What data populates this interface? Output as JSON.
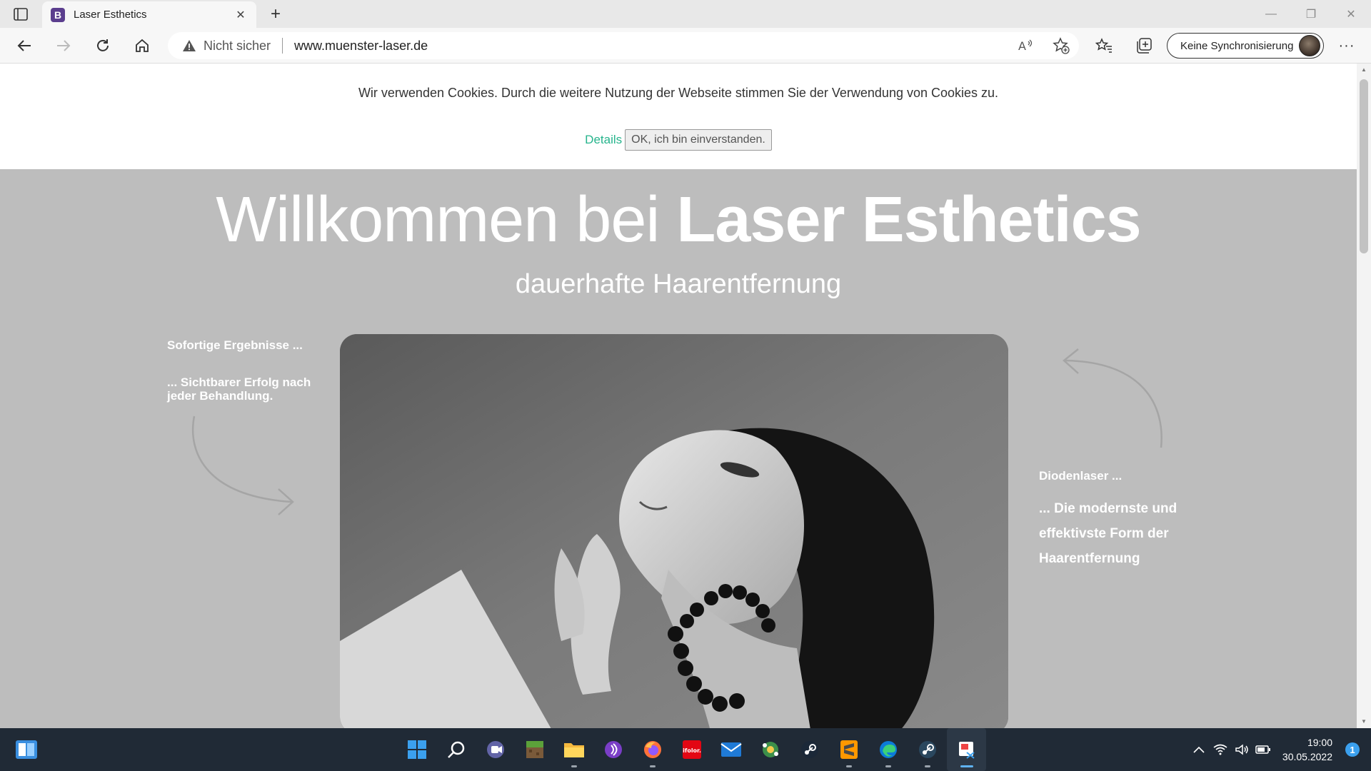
{
  "browser": {
    "tab_title": "Laser Esthetics",
    "favicon_letter": "B",
    "not_secure_label": "Nicht sicher",
    "url": "www.muenster-laser.de",
    "sync_label": "Keine Synchronisierung"
  },
  "cookie_banner": {
    "message": "Wir verwenden Cookies. Durch die weitere Nutzung der Webseite stimmen Sie der Verwendung von Cookies zu.",
    "details_link": "Details",
    "accept_button": "OK, ich bin einverstanden."
  },
  "hero": {
    "title_light": "Willkommen bei",
    "title_bold": "Laser Esthetics",
    "subtitle": "dauerhafte Haarentfernung"
  },
  "left_callout": {
    "heading": "Sofortige Ergebnisse ...",
    "text": "... Sichtbarer Erfolg nach jeder Behandlung."
  },
  "right_callout": {
    "heading": "Diodenlaser ...",
    "text": "... Die modernste und effektivste Form der Haarentfernung"
  },
  "taskbar": {
    "apps": [
      "start-icon",
      "search-icon",
      "teams-icon",
      "minecraft-icon",
      "file-explorer-icon",
      "podcast-icon",
      "firefox-icon",
      "ifolor-icon",
      "mail-icon",
      "network-app-icon",
      "steam-icon",
      "sublime-text-icon",
      "edge-icon",
      "steam-icon-2",
      "snipping-tool-icon"
    ],
    "app_label_ifolor": "ifolor.",
    "time": "19:00",
    "date": "30.05.2022",
    "notification_count": "1"
  },
  "colors": {
    "page_bg": "#bdbdbd",
    "details_link": "#26b48c",
    "taskbar_bg": "#202a36"
  }
}
